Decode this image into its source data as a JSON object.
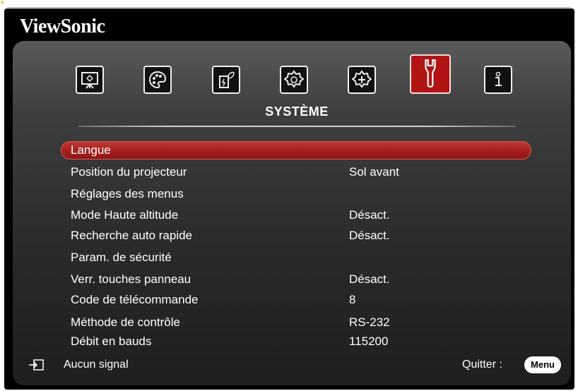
{
  "brand": "ViewSonic",
  "tabs": [
    {
      "icon": "display-icon"
    },
    {
      "icon": "palette-icon"
    },
    {
      "icon": "power-saving-icon"
    },
    {
      "icon": "basic-settings-icon"
    },
    {
      "icon": "advanced-settings-icon"
    },
    {
      "icon": "wrench-icon",
      "active": true
    },
    {
      "icon": "information-icon"
    }
  ],
  "tab_title": "SYSTÈME",
  "menu": [
    {
      "label": "Langue",
      "value": "",
      "selected": true
    },
    {
      "label": "Position du projecteur",
      "value": "Sol avant"
    },
    {
      "label": "Réglages des menus",
      "value": ""
    },
    {
      "label": "Mode Haute altitude",
      "value": "Désact."
    },
    {
      "label": "Recherche auto rapide",
      "value": "Désact."
    },
    {
      "label": "Param. de sécurité",
      "value": ""
    },
    {
      "label": "Verr. touches panneau",
      "value": "Désact."
    },
    {
      "label": "Code de télécommande",
      "value": "8"
    },
    {
      "label": "Méthode de contrôle",
      "value": "RS-232"
    },
    {
      "label": "Débit en bauds",
      "value": "115200"
    }
  ],
  "footer": {
    "status": "Aucun signal",
    "status_icon": "input-source-icon",
    "exit_label": "Quitter :",
    "menu_button": "Menu"
  },
  "colors": {
    "selection": "#a11c1c",
    "active_tab": "#b01414"
  }
}
